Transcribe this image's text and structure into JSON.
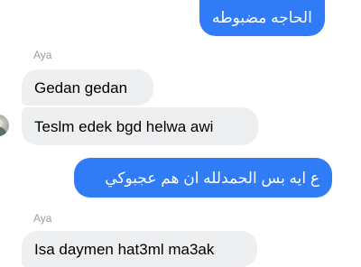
{
  "colors": {
    "accent": "#2f7cf6",
    "incoming": "#eeeff1",
    "meta": "#9a9ca0"
  },
  "conversation": {
    "messages": [
      {
        "direction": "outgoing",
        "text": "الحاجه مضبوطه"
      },
      {
        "direction": "incoming",
        "sender": "Aya",
        "text": "Gedan gedan"
      },
      {
        "direction": "incoming",
        "text": "Teslm edek bgd helwa awi"
      },
      {
        "direction": "outgoing",
        "text": "ع ايه بس الحمدلله ان هم عجبوكي"
      },
      {
        "direction": "incoming",
        "sender": "Aya",
        "text": "Isa daymen hat3ml ma3ak"
      }
    ]
  }
}
